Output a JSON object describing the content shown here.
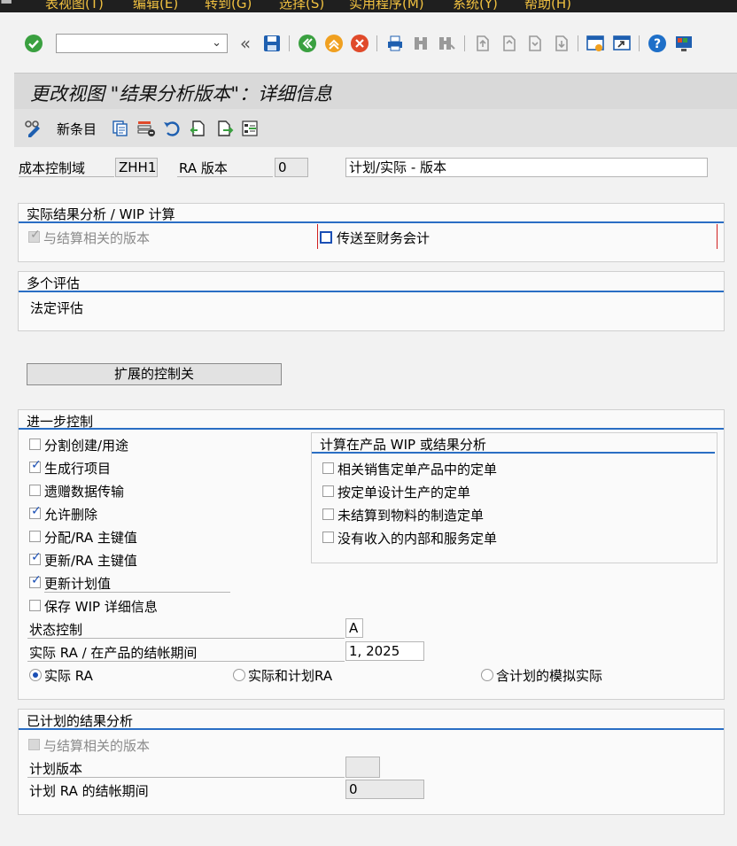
{
  "menu": [
    "表视图(T)",
    "编辑(E)",
    "转到(G)",
    "选择(S)",
    "实用程序(M)",
    "系统(Y)",
    "帮助(H)"
  ],
  "toolbar": {
    "command_value": ""
  },
  "page_title": "更改视图 \"结果分析版本\"：详细信息",
  "app_toolbar": {
    "new_entries": "新条目"
  },
  "header": {
    "controlling_area_label": "成本控制域",
    "controlling_area_value": "ZHH1",
    "ra_version_label": "RA 版本",
    "ra_version_value": "0",
    "version_text": "计划/实际 - 版本"
  },
  "actual_ra": {
    "title": "实际结果分析 / WIP 计算",
    "settlement_version_label": "与结算相关的版本",
    "settlement_version_checked": true,
    "transfer_fi_label": "传送至财务会计",
    "transfer_fi_checked": false
  },
  "multiple_valuation": {
    "title": "多个评估",
    "legal_valuation": "法定评估"
  },
  "ext_control_button": "扩展的控制关",
  "further_control": {
    "title": "进一步控制",
    "options": [
      {
        "label": "分割创建/用途",
        "checked": false
      },
      {
        "label": "生成行项目",
        "checked": true
      },
      {
        "label": "遗赠数据传输",
        "checked": false
      },
      {
        "label": "允许删除",
        "checked": true
      },
      {
        "label": "分配/RA 主键值",
        "checked": false
      },
      {
        "label": "更新/RA 主键值",
        "checked": true
      },
      {
        "label": "更新计划值",
        "checked": true
      },
      {
        "label": "保存 WIP 详细信息",
        "checked": false
      }
    ],
    "calc_group_title": "计算在产品 WIP 或结果分析",
    "calc_options": [
      {
        "label": "相关销售定单产品中的定单",
        "checked": false
      },
      {
        "label": "按定单设计生产的定单",
        "checked": false
      },
      {
        "label": "未结算到物料的制造定单",
        "checked": false
      },
      {
        "label": "没有收入的内部和服务定单",
        "checked": false
      }
    ],
    "status_control_label": "状态控制",
    "status_control_value": "A",
    "closing_period_label": "实际 RA / 在产品的结帐期间",
    "closing_period_value": "1, 2025",
    "radio_options": [
      {
        "label": "实际 RA",
        "selected": true
      },
      {
        "label": "实际和计划RA",
        "selected": false
      },
      {
        "label": "含计划的模拟实际",
        "selected": false
      }
    ]
  },
  "planned_ra": {
    "title": "已计划的结果分析",
    "settlement_version_label": "与结算相关的版本",
    "plan_version_label": "计划版本",
    "plan_version_value": "",
    "plan_closing_label": "计划 RA 的结帐期间",
    "plan_closing_value": "0"
  },
  "colors": {
    "accent": "#2a6ec4",
    "menu_text": "#f0c040",
    "title_bg": "#d9d9d9",
    "check": "#1a4fb5"
  }
}
